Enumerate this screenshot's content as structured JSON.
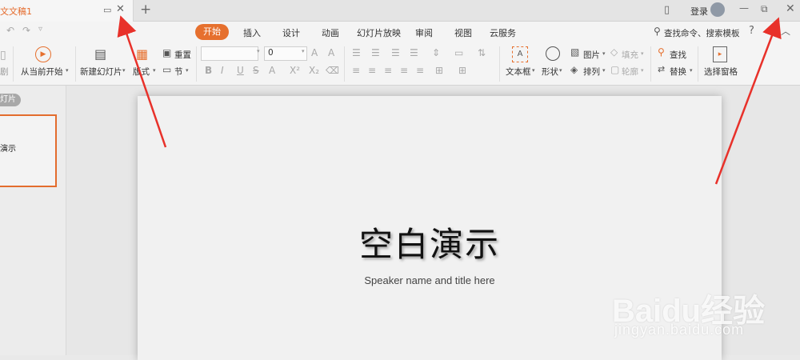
{
  "titlebar": {
    "doc_title": "文文稿1",
    "login": "登录",
    "new_tab": "+",
    "close": "✕"
  },
  "tabs": [
    {
      "label": "开始",
      "active": true
    },
    {
      "label": "插入"
    },
    {
      "label": "设计"
    },
    {
      "label": "动画"
    },
    {
      "label": "幻灯片放映"
    },
    {
      "label": "审阅"
    },
    {
      "label": "视图"
    },
    {
      "label": "云服务"
    }
  ],
  "search": {
    "placeholder": "查找命令、搜索模板",
    "help": "?"
  },
  "ribbon": {
    "from_current": "从当前开始",
    "new_slide": "新建幻灯片",
    "layout": "版式",
    "reset": "重置",
    "section": "节",
    "font_size": "0",
    "textbox": "文本框",
    "shape": "形状",
    "picture": "图片",
    "fill": "填充",
    "arrange": "排列",
    "outline": "轮廓",
    "find": "查找",
    "replace": "替换",
    "select_pane": "选择窗格",
    "left_cut": "剧"
  },
  "leftpanel": {
    "tab": "灯片",
    "thumb_title": "演示"
  },
  "slide": {
    "title": "空白演示",
    "subtitle": "Speaker name and title here"
  },
  "watermark": {
    "logo": "Baidu经验",
    "url": "jingyan.baidu.com"
  },
  "colors": {
    "accent": "#e6702e",
    "arrow": "#e8312a"
  }
}
